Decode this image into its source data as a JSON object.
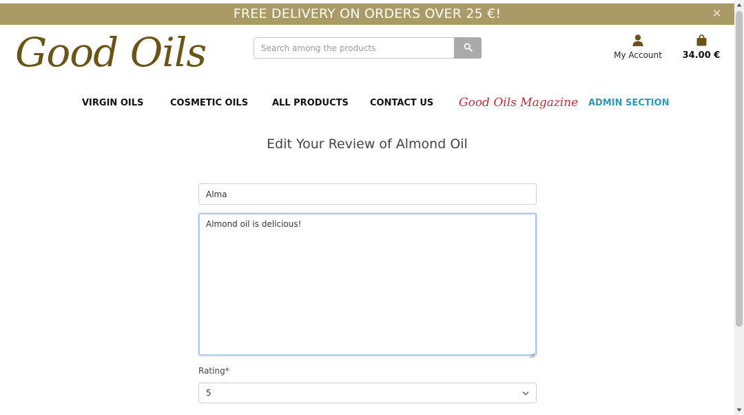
{
  "banner": {
    "text": "FREE DELIVERY ON ORDERS OVER 25 €!",
    "close_label": "✕"
  },
  "header": {
    "logo_text": "Good Oils",
    "search_placeholder": "Search among the products",
    "account_label": "My Account",
    "cart_total": "34.00 €"
  },
  "nav": {
    "items": [
      "VIRGIN OILS",
      "COSMETIC OILS",
      "ALL PRODUCTS",
      "CONTACT US",
      "Good Oils Magazine",
      "ADMIN SECTION"
    ]
  },
  "form": {
    "title": "Edit Your Review of Almond Oil",
    "name_value": "Alma",
    "review_value": "Almond oil is delicious!",
    "rating_label": "Rating*",
    "rating_value": "5"
  },
  "colors": {
    "banner_bg": "#aa9a66",
    "brand_brown": "#6b5418",
    "magazine_red": "#b8303c",
    "admin_teal": "#2a9ab5",
    "search_button": "#aaaaaa"
  },
  "icons": {
    "banner_close": "close-icon",
    "search": "search-icon",
    "account": "user-icon",
    "cart": "shopping-bag-icon",
    "select": "chevron-down-icon"
  }
}
